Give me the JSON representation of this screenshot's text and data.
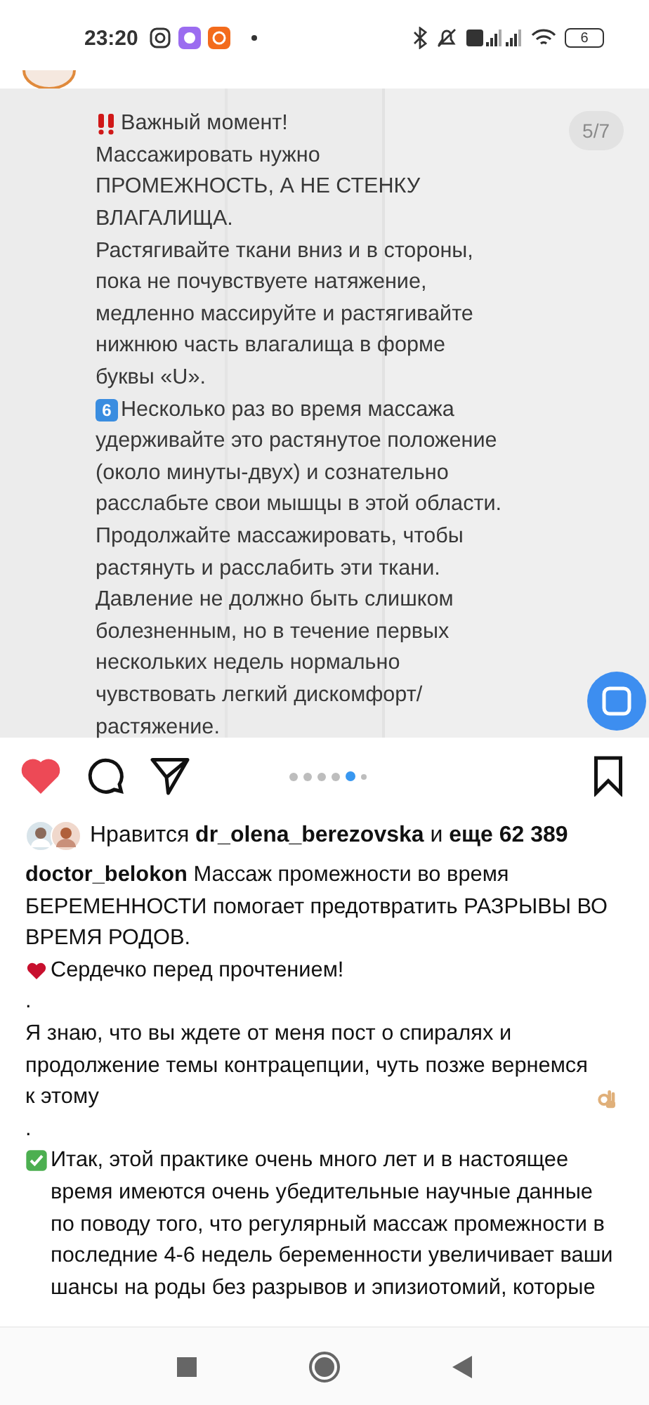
{
  "status_bar": {
    "time": "23:20",
    "battery": "6"
  },
  "slide": {
    "counter": "5/7",
    "lines": [
      {
        "kind": "alert",
        "text": "Важный момент!"
      },
      {
        "text": "Массажировать нужно"
      },
      {
        "text": "ПРОМЕЖНОСТЬ, А НЕ СТЕНКУ"
      },
      {
        "text": "ВЛАГАЛИЩА."
      },
      {
        "text": "Растягивайте ткани вниз и в стороны,"
      },
      {
        "text": "пока не почувствуете натяжение,"
      },
      {
        "text": "медленно массируйте и растягивайте"
      },
      {
        "text": "нижнюю часть влагалища в форме"
      },
      {
        "text": "буквы «U»."
      },
      {
        "keycap": "6",
        "text": "Несколько раз во время массажа"
      },
      {
        "text": "удерживайте это растянутое положение"
      },
      {
        "text": "(около минуты-двух) и сознательно"
      },
      {
        "text": "расслабьте свои мышцы в этой области."
      },
      {
        "text": "Продолжайте массажировать, чтобы"
      },
      {
        "text": "растянуть и расслабить эти ткани."
      },
      {
        "text": "Давление не должно быть слишком"
      },
      {
        "text": "болезненным, но в течение первых"
      },
      {
        "text": "нескольких недель нормально"
      },
      {
        "text": "чувствовать легкий дискомфорт/"
      },
      {
        "text": "растяжение."
      }
    ]
  },
  "actions": {
    "liked": true,
    "saved": false,
    "dots": [
      {
        "selected": false
      },
      {
        "selected": false
      },
      {
        "selected": false
      },
      {
        "selected": false
      },
      {
        "selected": true
      },
      {
        "selected": false
      }
    ]
  },
  "likes": "Нравится **dr_olena_berezovska** и **еще 62 389**",
  "caption": [
    {
      "text": "**doctor_belokon** Массаж промежности во время БЕРЕМЕННОСТИ помогает предотвратить РАЗРЫВЫ ВО ВРЕМЯ РОДОВ."
    },
    {
      "kind": "heart",
      "text": "Сердечко перед прочтением!"
    },
    {
      "text": "."
    },
    {
      "text": "Я знаю, что вы ждете от меня пост о спиралях и продолжение темы контрацепции, чуть позже вернемся к этому",
      "kind": "approval"
    },
    {
      "text": "."
    },
    {
      "kind": "check",
      "text": "Итак, этой практике очень много лет и в настоящее время имеются очень убедительные научные данные по поводу того, что регулярный массаж промежности в последние 4-6 недель беременности увеличивает ваши шансы на роды без разрывов и эпизиотомий, которые"
    }
  ]
}
